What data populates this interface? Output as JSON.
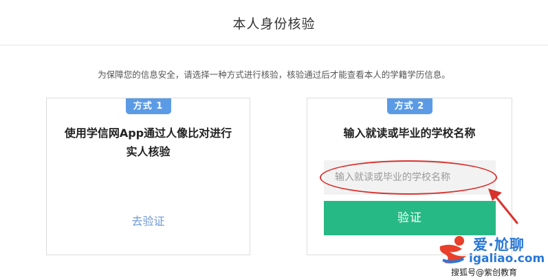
{
  "header": {
    "title": "本人身份核验"
  },
  "notice": "为保障您的信息安全，请选择一种方式进行核验，核验通过后才能查看本人的学籍学历信息。",
  "method1": {
    "badge": "方式 1",
    "heading": "使用学信网App通过人像比对进行实人核验",
    "link": "去验证"
  },
  "method2": {
    "badge": "方式 2",
    "heading": "输入就读或毕业的学校名称",
    "input_placeholder": "输入就读或毕业的学校名称",
    "input_value": "",
    "button": "验证"
  },
  "annotation": {
    "color": "#d8322d"
  },
  "watermark": {
    "logo_text": "爱·尬聊",
    "site": "igaliao.com",
    "credit": "搜狐号@紫创教育"
  },
  "colors": {
    "badge": "#5b9be6",
    "link": "#6d98d6",
    "button": "#27b985",
    "watermark": "#2a78d6"
  }
}
